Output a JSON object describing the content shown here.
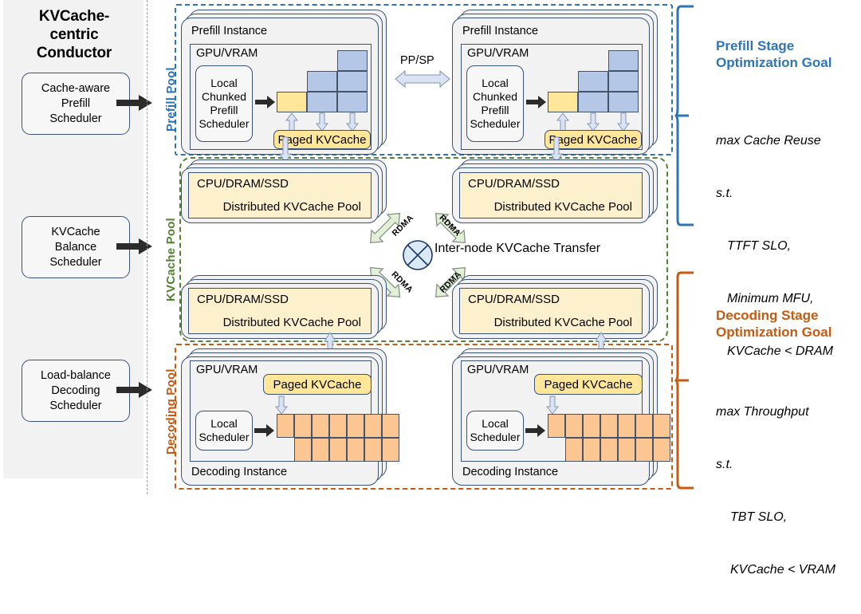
{
  "conductor": {
    "title": "KVCache-centric\nConductor",
    "title_lines": [
      "KVCache-",
      "centric",
      "Conductor"
    ],
    "schedulers": [
      {
        "label": "Cache-aware\nPrefill\nScheduler",
        "target": "Prefill Pool"
      },
      {
        "label": "KVCache\nBalance\nScheduler",
        "target": "KVCache Pool"
      },
      {
        "label": "Load-balance\nDecoding\nScheduler",
        "target": "Decoding Pool"
      }
    ]
  },
  "pools": {
    "prefill": {
      "label": "Prefill Pool",
      "color": "#2e75b6"
    },
    "kvcache": {
      "label": "KVCache Pool",
      "color": "#548235"
    },
    "decoding": {
      "label": "Decoding Pool",
      "color": "#c55a11"
    }
  },
  "prefill_instances": [
    {
      "instance_label": "Prefill Instance",
      "memory_label": "GPU/VRAM",
      "scheduler_label": "Local\nChunked\nPrefill\nScheduler",
      "cache_label": "Paged KVCache",
      "chunk_columns": [
        {
          "height": 1,
          "color": "yellow"
        },
        {
          "height": 2,
          "color": "blue"
        },
        {
          "height": 3,
          "color": "blue"
        }
      ]
    },
    {
      "instance_label": "Prefill Instance",
      "memory_label": "GPU/VRAM",
      "scheduler_label": "Local\nChunked\nPrefill\nScheduler",
      "cache_label": "Paged KVCache",
      "chunk_columns": [
        {
          "height": 1,
          "color": "yellow"
        },
        {
          "height": 2,
          "color": "blue"
        },
        {
          "height": 3,
          "color": "blue"
        }
      ]
    }
  ],
  "kvcache_nodes": [
    {
      "memory_label": "CPU/DRAM/SSD",
      "pool_label": "Distributed KVCache Pool"
    },
    {
      "memory_label": "CPU/DRAM/SSD",
      "pool_label": "Distributed KVCache Pool"
    },
    {
      "memory_label": "CPU/DRAM/SSD",
      "pool_label": "Distributed KVCache Pool"
    },
    {
      "memory_label": "CPU/DRAM/SSD",
      "pool_label": "Distributed KVCache Pool"
    }
  ],
  "decoding_instances": [
    {
      "instance_label": "Decoding Instance",
      "memory_label": "GPU/VRAM",
      "scheduler_label": "Local\nScheduler",
      "cache_label": "Paged KVCache",
      "batch_rows": [
        7,
        6
      ]
    },
    {
      "instance_label": "Decoding Instance",
      "memory_label": "GPU/VRAM",
      "scheduler_label": "Local\nScheduler",
      "cache_label": "Paged KVCache",
      "batch_rows": [
        7,
        6
      ]
    }
  ],
  "interconnect": {
    "transfer_label": "Inter-node KVCache Transfer",
    "link_label": "RDMA",
    "links": [
      "RDMA",
      "RDMA",
      "RDMA",
      "RDMA"
    ],
    "parallel_label": "PP/SP"
  },
  "goals": {
    "prefill": {
      "title": "Prefill Stage\nOptimization Goal",
      "title_lines": [
        "Prefill Stage",
        "Optimization Goal"
      ],
      "objective": "max Cache Reuse",
      "subject_to": "s.t.",
      "constraints": [
        "TTFT SLO,",
        "Minimum MFU,",
        "KVCache < DRAM"
      ],
      "body": "max Cache Reuse\ns.t.\n  TTFT SLO,\n  Minimum MFU,\n  KVCache < DRAM",
      "color": "#2e75b6"
    },
    "decoding": {
      "title": "Decoding Stage\nOptimization Goal",
      "title_lines": [
        "Decoding Stage",
        "Optimization Goal"
      ],
      "objective": "max Throughput",
      "subject_to": "s.t.",
      "constraints": [
        "TBT SLO,",
        "KVCache < VRAM"
      ],
      "body": "max Throughput\ns.t.\n   TBT SLO,\n   KVCache < VRAM",
      "color": "#c55a11"
    }
  },
  "colors": {
    "prefill_blue": "#2e75b6",
    "kvcache_green": "#548235",
    "decoding_orange": "#c55a11",
    "cache_yellow": "#ffe699",
    "dram_yellow": "#fdf0cd",
    "chunk_blue": "#b4c7e7",
    "batch_orange": "#fbc692",
    "box_outline": "#3b5278",
    "panel_gray": "#f2f2f2"
  }
}
